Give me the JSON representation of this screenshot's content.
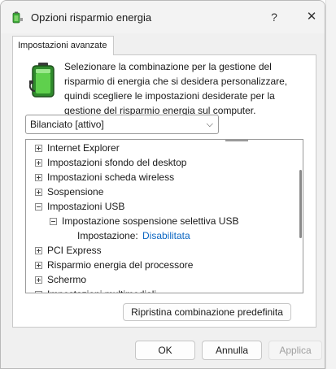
{
  "window": {
    "title": "Opzioni risparmio energia",
    "help_glyph": "?",
    "close_glyph": "✕"
  },
  "tab": {
    "label": "Impostazioni avanzate"
  },
  "description": "Selezionare la combinazione per la gestione del risparmio di energia che si desidera personalizzare, quindi scegliere le impostazioni desiderate per la gestione del risparmio energia sul computer.",
  "plan_select": {
    "value": "Bilanciato [attivo]",
    "chevron": "⌵"
  },
  "tree": {
    "items": [
      {
        "label": "Internet Explorer",
        "expander": "plus"
      },
      {
        "label": "Impostazioni sfondo del desktop",
        "expander": "plus"
      },
      {
        "label": "Impostazioni scheda wireless",
        "expander": "plus"
      },
      {
        "label": "Sospensione",
        "expander": "plus"
      },
      {
        "label": "Impostazioni USB",
        "expander": "minus"
      },
      {
        "label": "Impostazione sospensione selettiva USB",
        "expander": "minus"
      },
      {
        "label": "Impostazione:",
        "value": "Disabilitata"
      },
      {
        "label": "PCI Express",
        "expander": "plus"
      },
      {
        "label": "Risparmio energia del processore",
        "expander": "plus"
      },
      {
        "label": "Schermo",
        "expander": "plus"
      },
      {
        "label": "Impostazioni multimediali",
        "expander": "plus"
      }
    ]
  },
  "buttons": {
    "restore": "Ripristina combinazione predefinita",
    "ok": "OK",
    "cancel": "Annulla",
    "apply": "Applica"
  },
  "icons": {
    "title_icon": "battery-plug-icon",
    "main_icon": "battery-icon"
  },
  "colors": {
    "link": "#0b66c2",
    "battery_green": "#3aa935"
  }
}
